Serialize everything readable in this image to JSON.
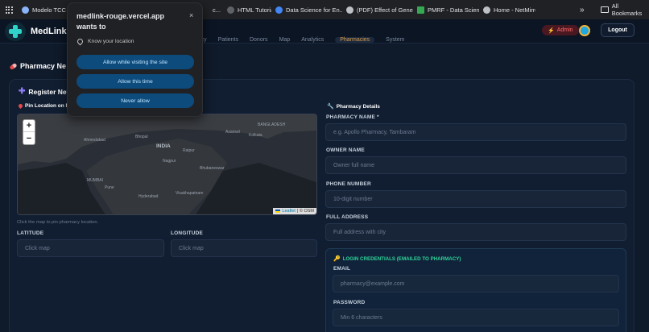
{
  "bookmarks": {
    "items": [
      {
        "label": "Modelo TCC C",
        "color": "#8ab4f8"
      },
      {
        "label": "c...",
        "color": "#5f6368"
      },
      {
        "label": "HTML Tutorial",
        "color": "#5f6368"
      },
      {
        "label": "Data Science for En...",
        "color": "#4285f4"
      },
      {
        "label": "(PDF) Effect of Gene...",
        "color": "#bdc1c6"
      },
      {
        "label": "PMRF - Data Scienc...",
        "color": "#34a853"
      },
      {
        "label": "Home - NetMirror",
        "color": "#bdc1c6"
      }
    ],
    "more": "»",
    "all_label": "All Bookmarks"
  },
  "header": {
    "app_name": "MedLink",
    "nav": [
      {
        "label": "gency",
        "active": false
      },
      {
        "label": "Patients",
        "active": false
      },
      {
        "label": "Donors",
        "active": false
      },
      {
        "label": "Map",
        "active": false
      },
      {
        "label": "Analytics",
        "active": false
      },
      {
        "label": "Pharmacies",
        "active": true
      },
      {
        "label": "System",
        "active": false
      }
    ],
    "admin_badge": "Admin",
    "logout_label": "Logout"
  },
  "page": {
    "title": "Pharmacy Ne",
    "card_title": "Register Nev",
    "pin_label": "Pin Location on M",
    "map_hint": "Click the map to pin pharmacy location.",
    "map": {
      "zoom_in": "+",
      "zoom_out": "−",
      "labels": {
        "bangladesh": "BANGLADESH",
        "india": "INDIA",
        "ahmedabad": "Ahmedabad",
        "bhopal": "Bhopal",
        "raipur": "Raipur",
        "asansol": "Asansol",
        "kolkata": "Kolkata",
        "nagpur": "Nagpur",
        "bhubaneswar": "Bhubaneswar",
        "mumbai": "MUMBAI",
        "pune": "Pune",
        "hyderabad": "Hyderabad",
        "visakhapatnam": "Visakhapatnam"
      },
      "attribution_link": "Leaflet",
      "attribution_rest": "| © OSM"
    },
    "latitude": {
      "label": "LATITUDE",
      "placeholder": "Click map"
    },
    "longitude": {
      "label": "LONGITUDE",
      "placeholder": "Click map"
    },
    "details_title": "Pharmacy Details",
    "pharmacy_name": {
      "label": "PHARMACY NAME *",
      "placeholder": "e.g. Apollo Pharmacy, Tambaram"
    },
    "owner_name": {
      "label": "OWNER NAME",
      "placeholder": "Owner full name"
    },
    "phone": {
      "label": "PHONE NUMBER",
      "placeholder": "10-digit number"
    },
    "address": {
      "label": "FULL ADDRESS",
      "placeholder": "Full address with city"
    },
    "credentials_title": "LOGIN CREDENTIALS (EMAILED TO PHARMACY)",
    "email": {
      "label": "EMAIL",
      "placeholder": "pharmacy@example.com"
    },
    "password": {
      "label": "PASSWORD",
      "placeholder": "Min 6 characters"
    }
  },
  "popup": {
    "title": "medlink-rouge.vercel.app wants to",
    "close": "×",
    "permission": "Know your location",
    "buttons": {
      "allow_visit": "Allow while visiting the site",
      "allow_once": "Allow this time",
      "never": "Never allow"
    }
  }
}
